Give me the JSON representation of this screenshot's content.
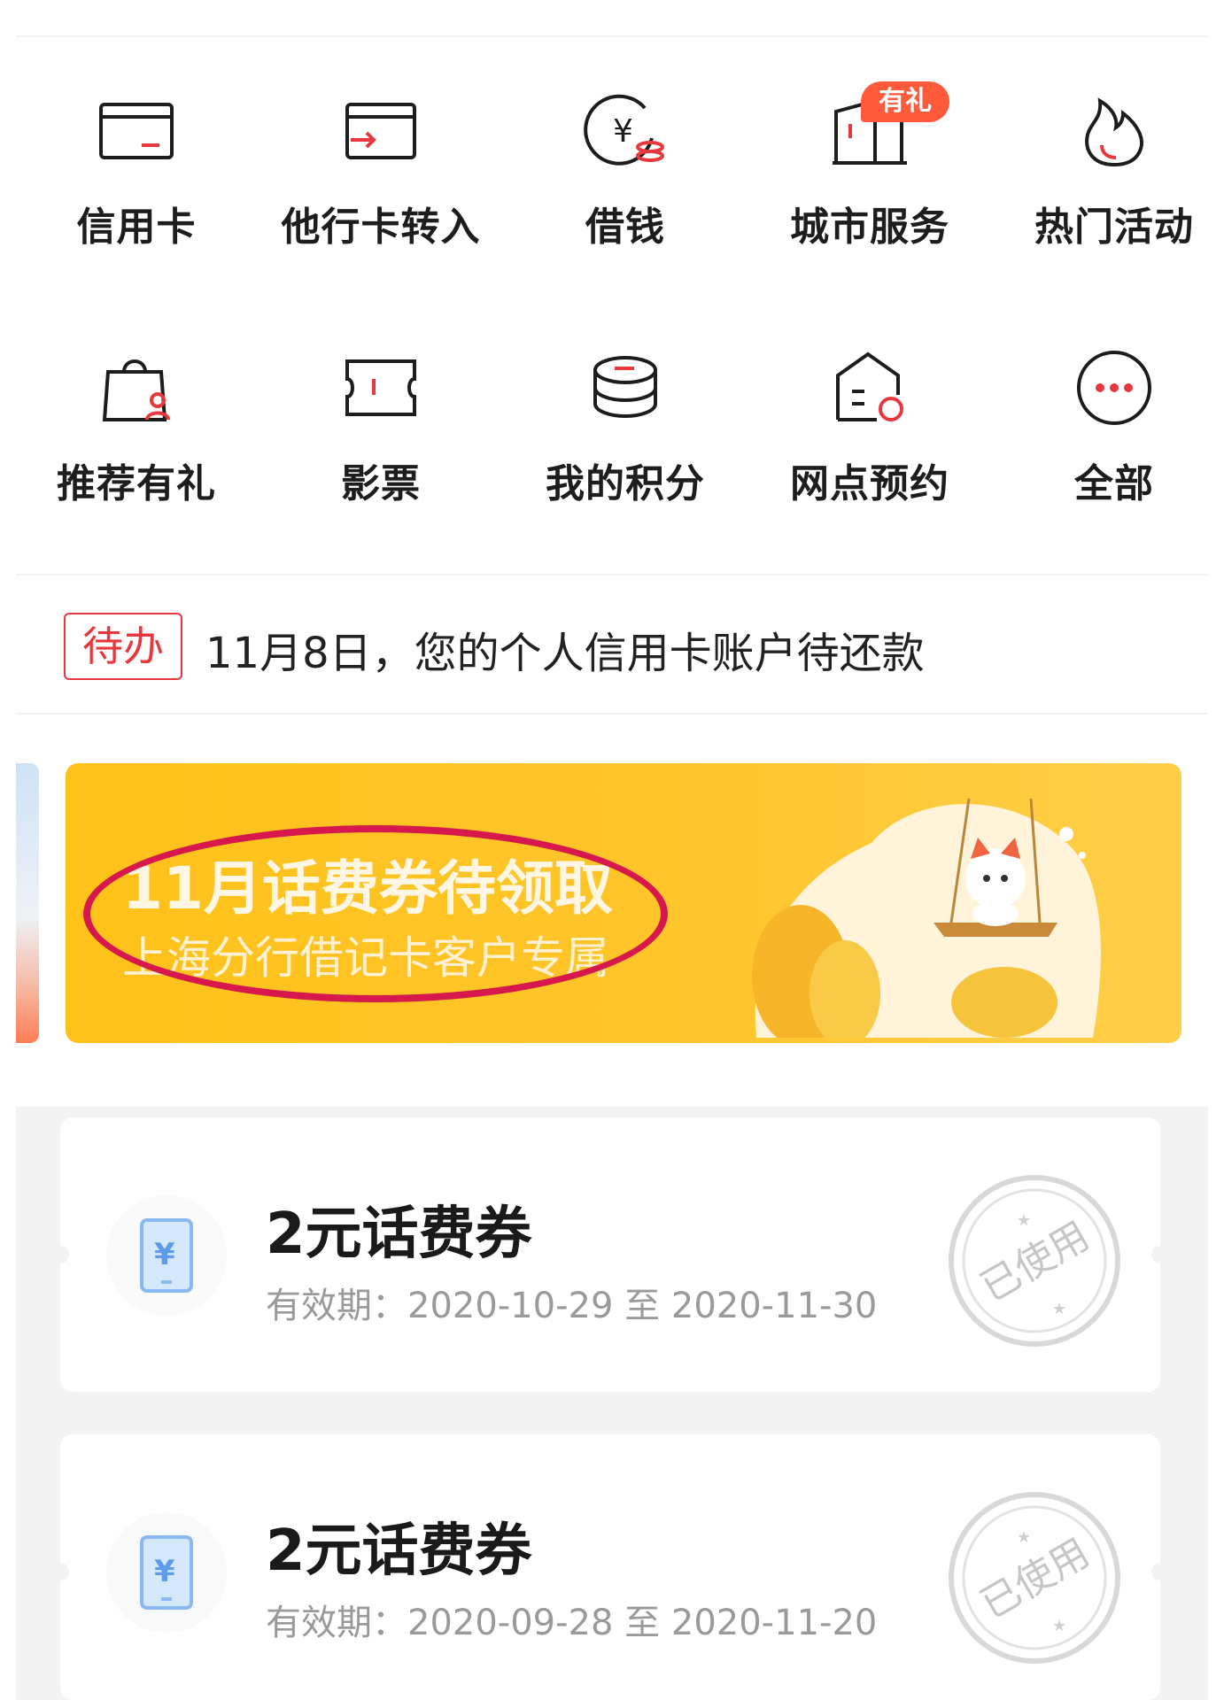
{
  "services": [
    {
      "label": "信用卡",
      "icon": "credit-card-icon"
    },
    {
      "label": "他行卡转入",
      "icon": "card-transfer-icon"
    },
    {
      "label": "借钱",
      "icon": "loan-yuan-icon"
    },
    {
      "label": "城市服务",
      "icon": "city-building-icon",
      "badge": "有礼"
    },
    {
      "label": "热门活动",
      "icon": "flame-icon"
    },
    {
      "label": "推荐有礼",
      "icon": "shopping-bag-user-icon"
    },
    {
      "label": "影票",
      "icon": "movie-ticket-icon"
    },
    {
      "label": "我的积分",
      "icon": "coins-stack-icon"
    },
    {
      "label": "网点预约",
      "icon": "branch-appointment-icon"
    },
    {
      "label": "全部",
      "icon": "more-dots-icon"
    }
  ],
  "todo": {
    "tag": "待办",
    "text": "11月8日，您的个人信用卡账户待还款"
  },
  "banner": {
    "title": "11月话费券待领取",
    "subtitle": "上海分行借记卡客户专属"
  },
  "coupons": [
    {
      "name": "2元话费券",
      "validity": "有效期：2020-10-29 至 2020-11-30",
      "status": "已使用"
    },
    {
      "name": "2元话费券",
      "validity": "有效期：2020-09-28 至 2020-11-20",
      "status": "已使用"
    }
  ],
  "colors": {
    "accent_red": "#e8383d",
    "badge_orange": "#ff5a3c",
    "banner_yellow": "#ffc21a",
    "highlight_magenta": "#d6184d",
    "coupon_icon_blue": "#8ab8f0"
  }
}
